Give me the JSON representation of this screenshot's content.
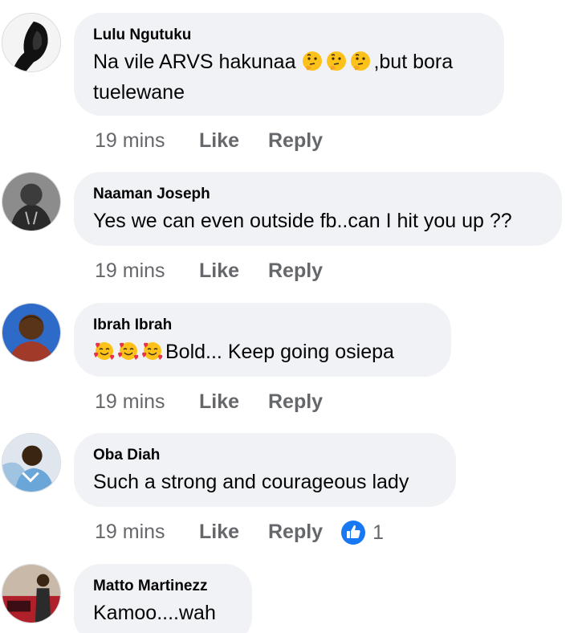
{
  "colors": {
    "bubble": "#f0f2f5",
    "meta_text": "#65676b",
    "like_blue": "#1877f2"
  },
  "comments": [
    {
      "author": "Lulu Ngutuku",
      "text_before": "Na vile ARVS hakunaa ",
      "emojis": [
        "thinking-face",
        "thinking-face",
        "thinking-face"
      ],
      "text_after": ",but bora tuelewane",
      "time": "19 mins",
      "like": "Like",
      "reply": "Reply"
    },
    {
      "author": "Naaman Joseph",
      "text": "Yes we can even outside fb..can I hit you up ??",
      "time": "19 mins",
      "like": "Like",
      "reply": "Reply"
    },
    {
      "author": "Ibrah Ibrah",
      "emojis": [
        "smiling-face-with-hearts",
        "smiling-face-with-hearts",
        "smiling-face-with-hearts"
      ],
      "text_after": "Bold... Keep going osiepa",
      "time": "19 mins",
      "like": "Like",
      "reply": "Reply"
    },
    {
      "author": "Oba Diah",
      "text": "Such a strong and courageous lady",
      "time": "19 mins",
      "like": "Like",
      "reply": "Reply",
      "reaction_icon": "like-icon",
      "reaction_count": "1"
    },
    {
      "author": "Matto Martinezz",
      "text": "Kamoo....wah"
    }
  ]
}
